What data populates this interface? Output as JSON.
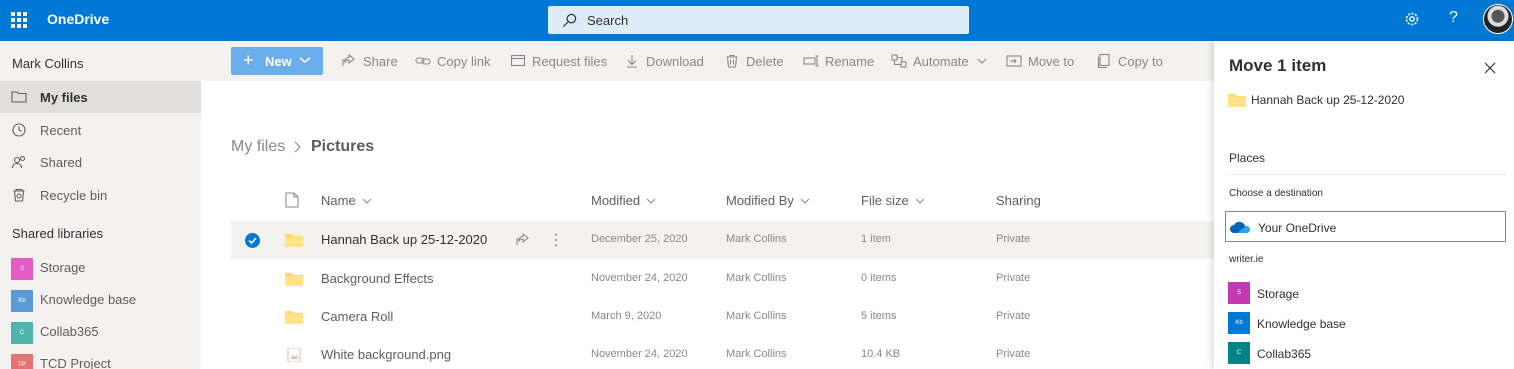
{
  "topbar": {
    "brand": "OneDrive",
    "search_placeholder": "Search",
    "help_label": "?",
    "colors": {
      "bar": "#0078d4"
    }
  },
  "nav": {
    "user": "Mark Collins",
    "items": [
      {
        "label": "My files",
        "icon": "folder-icon"
      },
      {
        "label": "Recent",
        "icon": "clock-icon"
      },
      {
        "label": "Shared",
        "icon": "people-icon"
      },
      {
        "label": "Recycle bin",
        "icon": "recycle-bin-icon"
      }
    ],
    "section": "Shared libraries",
    "libraries": [
      {
        "label": "Storage",
        "badge": "S",
        "color": "#e45bc7"
      },
      {
        "label": "Knowledge base",
        "badge": "Kb",
        "color": "#5b9bd5"
      },
      {
        "label": "Collab365",
        "badge": "C",
        "color": "#4db6ac"
      },
      {
        "label": "TCD Project",
        "badge": "TP",
        "color": "#e57373"
      }
    ]
  },
  "commands": {
    "new": "New",
    "share": "Share",
    "copy_link": "Copy link",
    "request_files": "Request files",
    "download": "Download",
    "delete": "Delete",
    "rename": "Rename",
    "automate": "Automate",
    "move_to": "Move to",
    "copy_to": "Copy to"
  },
  "breadcrumb": {
    "root": "My files",
    "current": "Pictures"
  },
  "table": {
    "headers": {
      "name": "Name",
      "modified": "Modified",
      "modified_by": "Modified By",
      "file_size": "File size",
      "sharing": "Sharing"
    },
    "rows": [
      {
        "name": "Hannah Back up 25-12-2020",
        "modified": "December 25, 2020",
        "modified_by": "Mark Collins",
        "size": "1 item",
        "sharing": "Private",
        "type": "folder",
        "selected": true
      },
      {
        "name": "Background Effects",
        "modified": "November 24, 2020",
        "modified_by": "Mark Collins",
        "size": "0 items",
        "sharing": "Private",
        "type": "folder"
      },
      {
        "name": "Camera Roll",
        "modified": "March 9, 2020",
        "modified_by": "Mark Collins",
        "size": "5 items",
        "sharing": "Private",
        "type": "folder"
      },
      {
        "name": "White background.png",
        "modified": "November 24, 2020",
        "modified_by": "Mark Collins",
        "size": "10.4 KB",
        "sharing": "Private",
        "type": "image"
      }
    ]
  },
  "panel": {
    "title": "Move 1 item",
    "item_name": "Hannah Back up 25-12-2020",
    "places": "Places",
    "choose": "Choose a destination",
    "destination": "Your OneDrive",
    "group": "writer.ie",
    "libraries": [
      {
        "label": "Storage",
        "badge": "S",
        "color": "#c239b3"
      },
      {
        "label": "Knowledge base",
        "badge": "Kb",
        "color": "#0078d4"
      },
      {
        "label": "Collab365",
        "badge": "C",
        "color": "#038387"
      }
    ]
  }
}
